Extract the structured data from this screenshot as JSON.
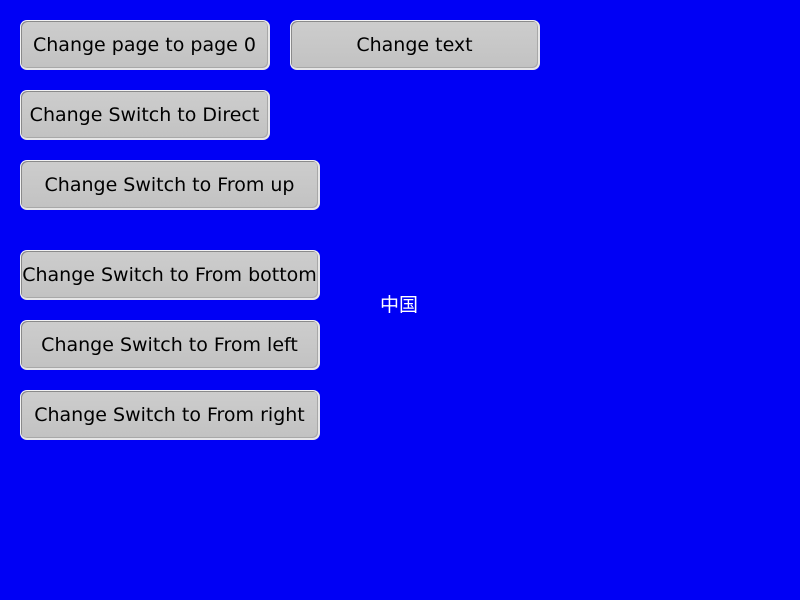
{
  "buttons": {
    "change_page": "Change page to page 0",
    "change_text": "Change text",
    "switch_direct": "Change Switch to Direct",
    "switch_from_up": "Change Switch to From up",
    "switch_from_bottom": "Change Switch to From bottom",
    "switch_from_left": "Change Switch to From left",
    "switch_from_right": "Change Switch to From right"
  },
  "center_label": "中国",
  "colors": {
    "background": "#0000f5",
    "button_face": "#c8c8c8",
    "button_text": "#000000",
    "label_text": "#ffffff"
  }
}
